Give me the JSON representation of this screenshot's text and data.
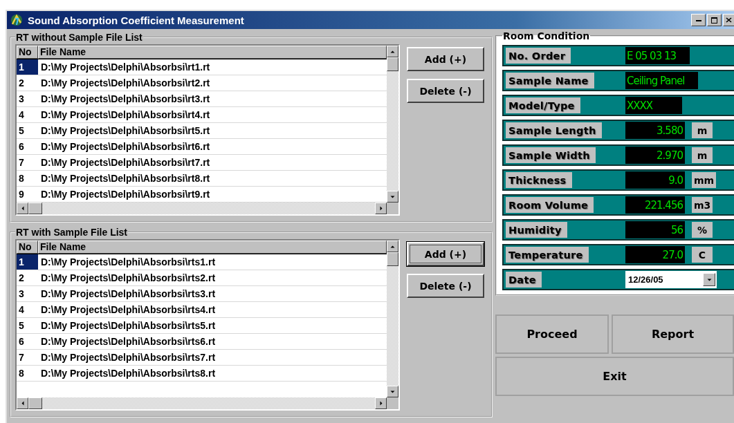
{
  "window": {
    "title": "Sound Absorption Coefficient Measurement"
  },
  "file_lists": [
    {
      "title": "RT without Sample File List",
      "columns": [
        "No",
        "File Name"
      ],
      "rows": [
        {
          "no": "1",
          "file": "D:\\My Projects\\Delphi\\Absorbsi\\rt1.rt",
          "selected": true
        },
        {
          "no": "2",
          "file": "D:\\My Projects\\Delphi\\Absorbsi\\rt2.rt",
          "selected": false
        },
        {
          "no": "3",
          "file": "D:\\My Projects\\Delphi\\Absorbsi\\rt3.rt",
          "selected": false
        },
        {
          "no": "4",
          "file": "D:\\My Projects\\Delphi\\Absorbsi\\rt4.rt",
          "selected": false
        },
        {
          "no": "5",
          "file": "D:\\My Projects\\Delphi\\Absorbsi\\rt5.rt",
          "selected": false
        },
        {
          "no": "6",
          "file": "D:\\My Projects\\Delphi\\Absorbsi\\rt6.rt",
          "selected": false
        },
        {
          "no": "7",
          "file": "D:\\My Projects\\Delphi\\Absorbsi\\rt7.rt",
          "selected": false
        },
        {
          "no": "8",
          "file": "D:\\My Projects\\Delphi\\Absorbsi\\rt8.rt",
          "selected": false
        },
        {
          "no": "9",
          "file": "D:\\My Projects\\Delphi\\Absorbsi\\rt9.rt",
          "selected": false
        }
      ],
      "buttons": [
        {
          "label": "Add (+)",
          "focused": false
        },
        {
          "label": "Delete (-)",
          "focused": false
        }
      ]
    },
    {
      "title": "RT with Sample File List",
      "columns": [
        "No",
        "File Name"
      ],
      "rows": [
        {
          "no": "1",
          "file": "D:\\My Projects\\Delphi\\Absorbsi\\rts1.rt",
          "selected": true
        },
        {
          "no": "2",
          "file": "D:\\My Projects\\Delphi\\Absorbsi\\rts2.rt",
          "selected": false
        },
        {
          "no": "3",
          "file": "D:\\My Projects\\Delphi\\Absorbsi\\rts3.rt",
          "selected": false
        },
        {
          "no": "4",
          "file": "D:\\My Projects\\Delphi\\Absorbsi\\rts4.rt",
          "selected": false
        },
        {
          "no": "5",
          "file": "D:\\My Projects\\Delphi\\Absorbsi\\rts5.rt",
          "selected": false
        },
        {
          "no": "6",
          "file": "D:\\My Projects\\Delphi\\Absorbsi\\rts6.rt",
          "selected": false
        },
        {
          "no": "7",
          "file": "D:\\My Projects\\Delphi\\Absorbsi\\rts7.rt",
          "selected": false
        },
        {
          "no": "8",
          "file": "D:\\My Projects\\Delphi\\Absorbsi\\rts8.rt",
          "selected": false
        }
      ],
      "buttons": [
        {
          "label": "Add (+)",
          "focused": true
        },
        {
          "label": "Delete (-)",
          "focused": false
        }
      ]
    }
  ],
  "room_condition": {
    "title": "Room Condition",
    "fields": [
      {
        "kind": "text",
        "label": "No. Order",
        "value": "E 05 03 13"
      },
      {
        "kind": "text",
        "label": "Sample Name",
        "value": "Ceiling Panel"
      },
      {
        "kind": "text",
        "label": "Model/Type",
        "value": "XXXX"
      },
      {
        "kind": "number",
        "label": "Sample Length",
        "value": "3.580",
        "unit": "m"
      },
      {
        "kind": "number",
        "label": "Sample Width",
        "value": "2.970",
        "unit": "m"
      },
      {
        "kind": "number",
        "label": "Thickness",
        "value": "9.0",
        "unit": "mm"
      },
      {
        "kind": "number",
        "label": "Room Volume",
        "value": "221.456",
        "unit": "m3"
      },
      {
        "kind": "number",
        "label": "Humidity",
        "value": "56",
        "unit": "%"
      },
      {
        "kind": "number",
        "label": "Temperature",
        "value": "27.0",
        "unit": "C"
      },
      {
        "kind": "date",
        "label": "Date",
        "value": "12/26/05"
      }
    ]
  },
  "actions": [
    {
      "label": "Proceed"
    },
    {
      "label": "Report"
    },
    {
      "label": "Exit"
    }
  ]
}
